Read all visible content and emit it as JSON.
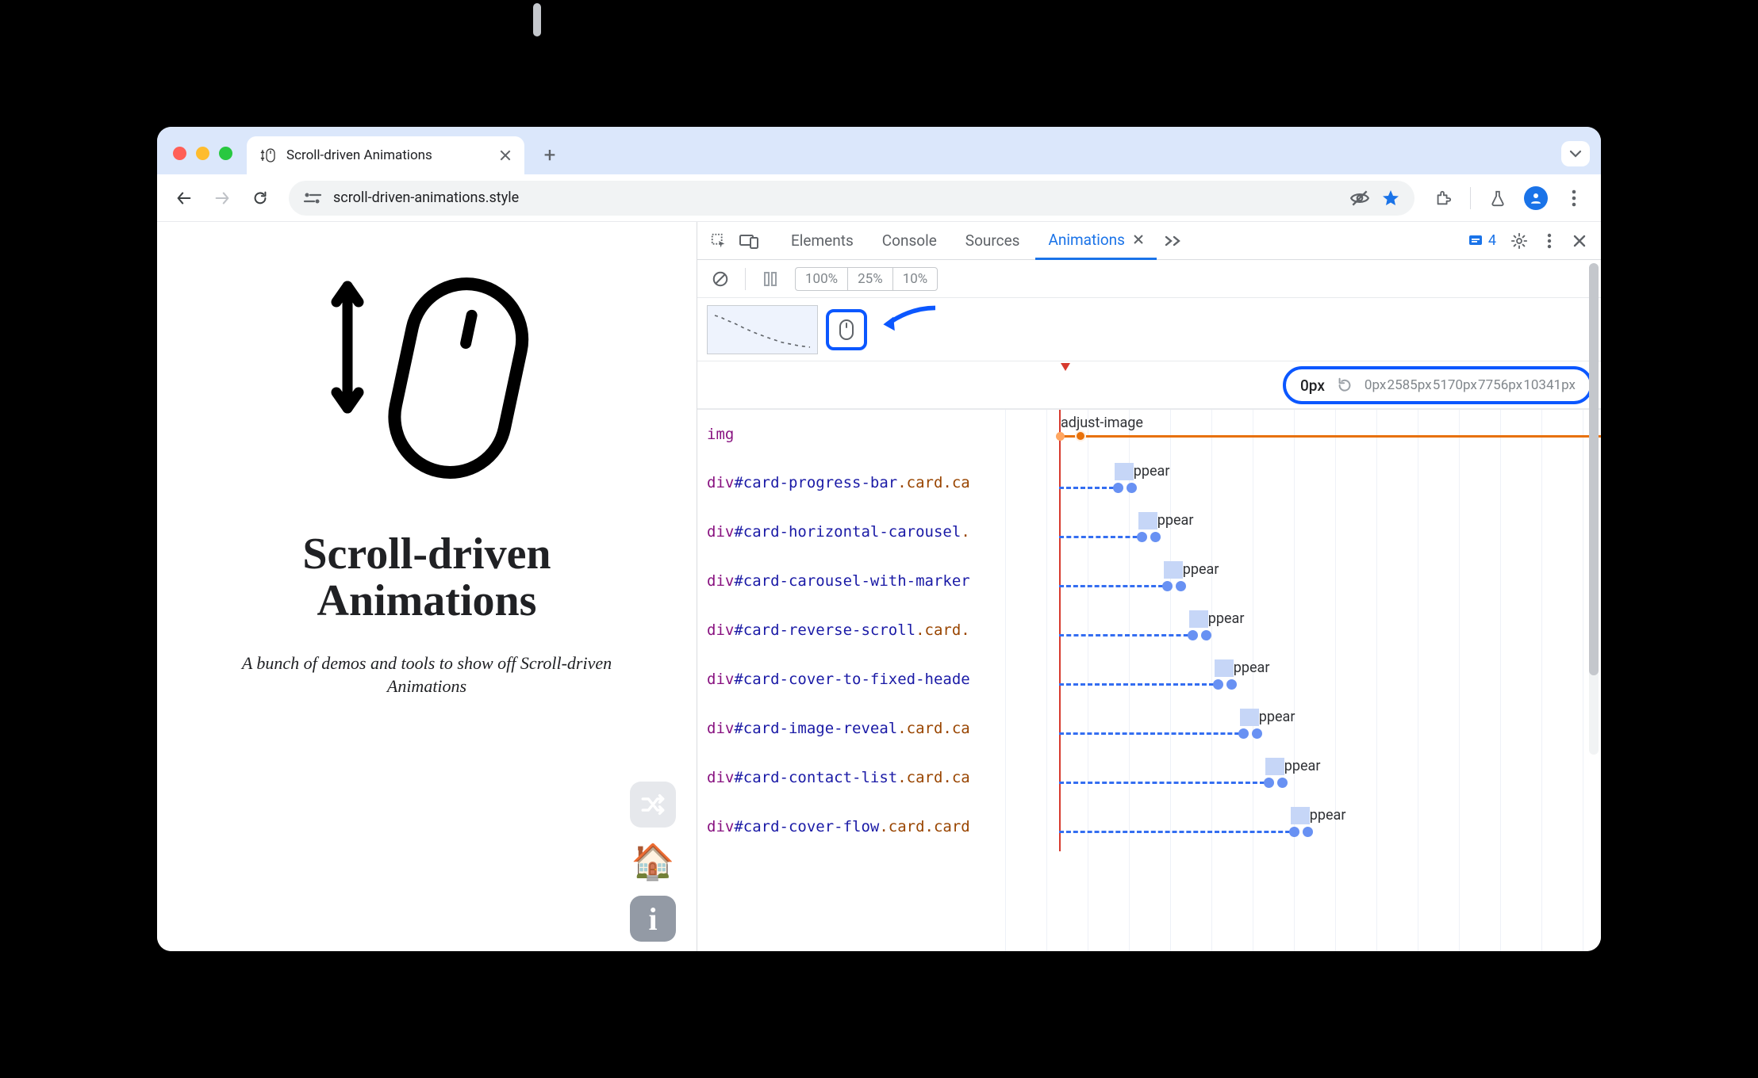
{
  "browser": {
    "tab_title": "Scroll-driven Animations",
    "url": "scroll-driven-animations.style"
  },
  "page": {
    "title_line1": "Scroll-driven",
    "title_line2": "Animations",
    "subtitle": "A bunch of demos and tools to show off Scroll-driven Animations"
  },
  "devtools": {
    "tabs": [
      "Elements",
      "Console",
      "Sources",
      "Animations"
    ],
    "active_tab": "Animations",
    "issues_count": "4",
    "speeds": [
      "100%",
      "25%",
      "10%"
    ],
    "ruler": {
      "current": "0px",
      "ticks": [
        "0px",
        "2585px",
        "5170px",
        "7756px",
        "10341px"
      ]
    },
    "rows": [
      {
        "tag": "img",
        "id": "",
        "cls": "",
        "anim": "adjust-image",
        "offset": 68,
        "is_img": true
      },
      {
        "tag": "div",
        "id": "#card-progress-bar",
        "cls": ".card.ca",
        "anim": "appear",
        "offset": 142
      },
      {
        "tag": "div",
        "id": "#card-horizontal-carousel",
        "cls": ".",
        "anim": "appear",
        "offset": 172
      },
      {
        "tag": "div",
        "id": "#card-carousel-with-marker",
        "cls": "",
        "anim": "appear",
        "offset": 204
      },
      {
        "tag": "div",
        "id": "#card-reverse-scroll",
        "cls": ".card.",
        "anim": "appear",
        "offset": 236
      },
      {
        "tag": "div",
        "id": "#card-cover-to-fixed-heade",
        "cls": "",
        "anim": "appear",
        "offset": 268
      },
      {
        "tag": "div",
        "id": "#card-image-reveal",
        "cls": ".card.ca",
        "anim": "appear",
        "offset": 300
      },
      {
        "tag": "div",
        "id": "#card-contact-list",
        "cls": ".card.ca",
        "anim": "appear",
        "offset": 332
      },
      {
        "tag": "div",
        "id": "#card-cover-flow",
        "cls": ".card.card",
        "anim": "appear",
        "offset": 364
      }
    ]
  }
}
